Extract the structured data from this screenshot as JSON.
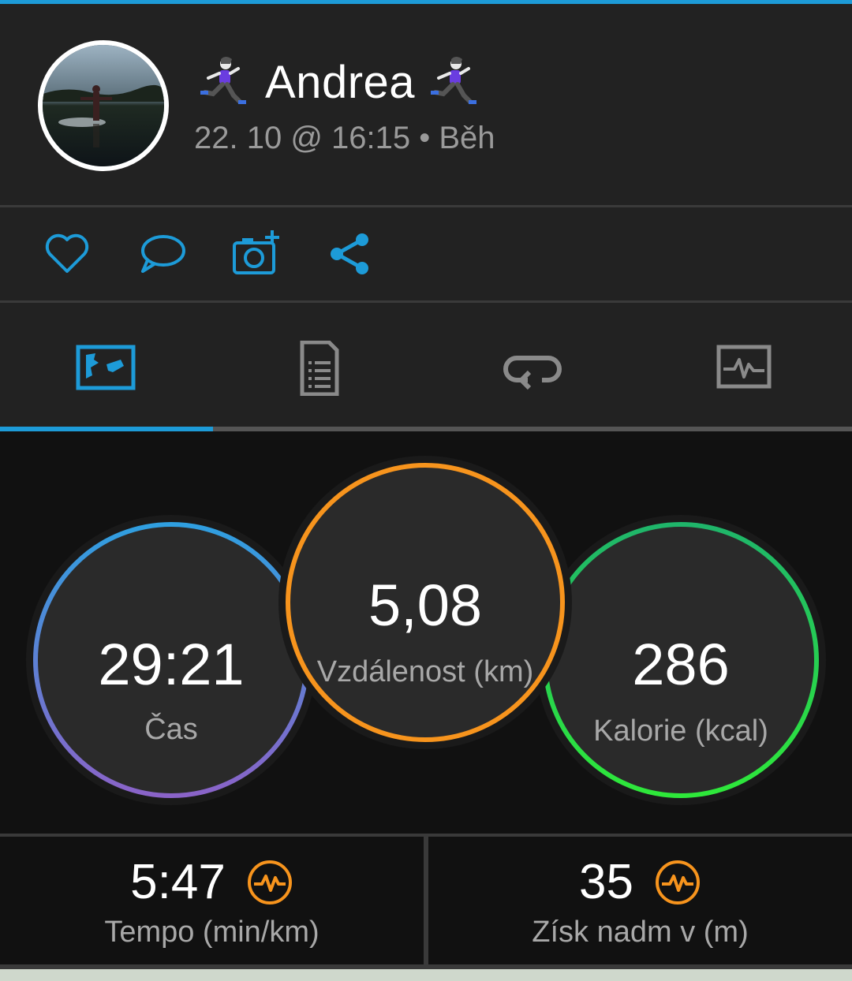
{
  "header": {
    "name": "Andrea",
    "subtitle": "22. 10 @ 16:15 • Běh",
    "left_emoji": "runner-icon",
    "right_emoji": "runner-icon"
  },
  "actions": [
    {
      "icon": "heart-icon"
    },
    {
      "icon": "comment-icon"
    },
    {
      "icon": "add-photo-icon"
    },
    {
      "icon": "share-icon"
    }
  ],
  "tabs": [
    {
      "icon": "map-icon",
      "selected": true
    },
    {
      "icon": "details-icon",
      "selected": false
    },
    {
      "icon": "laps-icon",
      "selected": false
    },
    {
      "icon": "chart-icon",
      "selected": false
    }
  ],
  "stats": {
    "time": {
      "value": "29:21",
      "label": "Čas"
    },
    "distance": {
      "value": "5,08",
      "label": "Vzdálenost (km)"
    },
    "calories": {
      "value": "286",
      "label": "Kalorie (kcal)"
    }
  },
  "metrics": {
    "pace": {
      "value": "5:47",
      "label": "Tempo (min/km)"
    },
    "elevation": {
      "value": "35",
      "label": "Získ nadm v (m)"
    }
  },
  "colors": {
    "accent": "#1d9bd8",
    "distance_ring": "#f7941d",
    "calories_ring": "#2ed83a",
    "time_ring_top": "#2f9fe0",
    "time_ring_bottom": "#8a63c8"
  }
}
